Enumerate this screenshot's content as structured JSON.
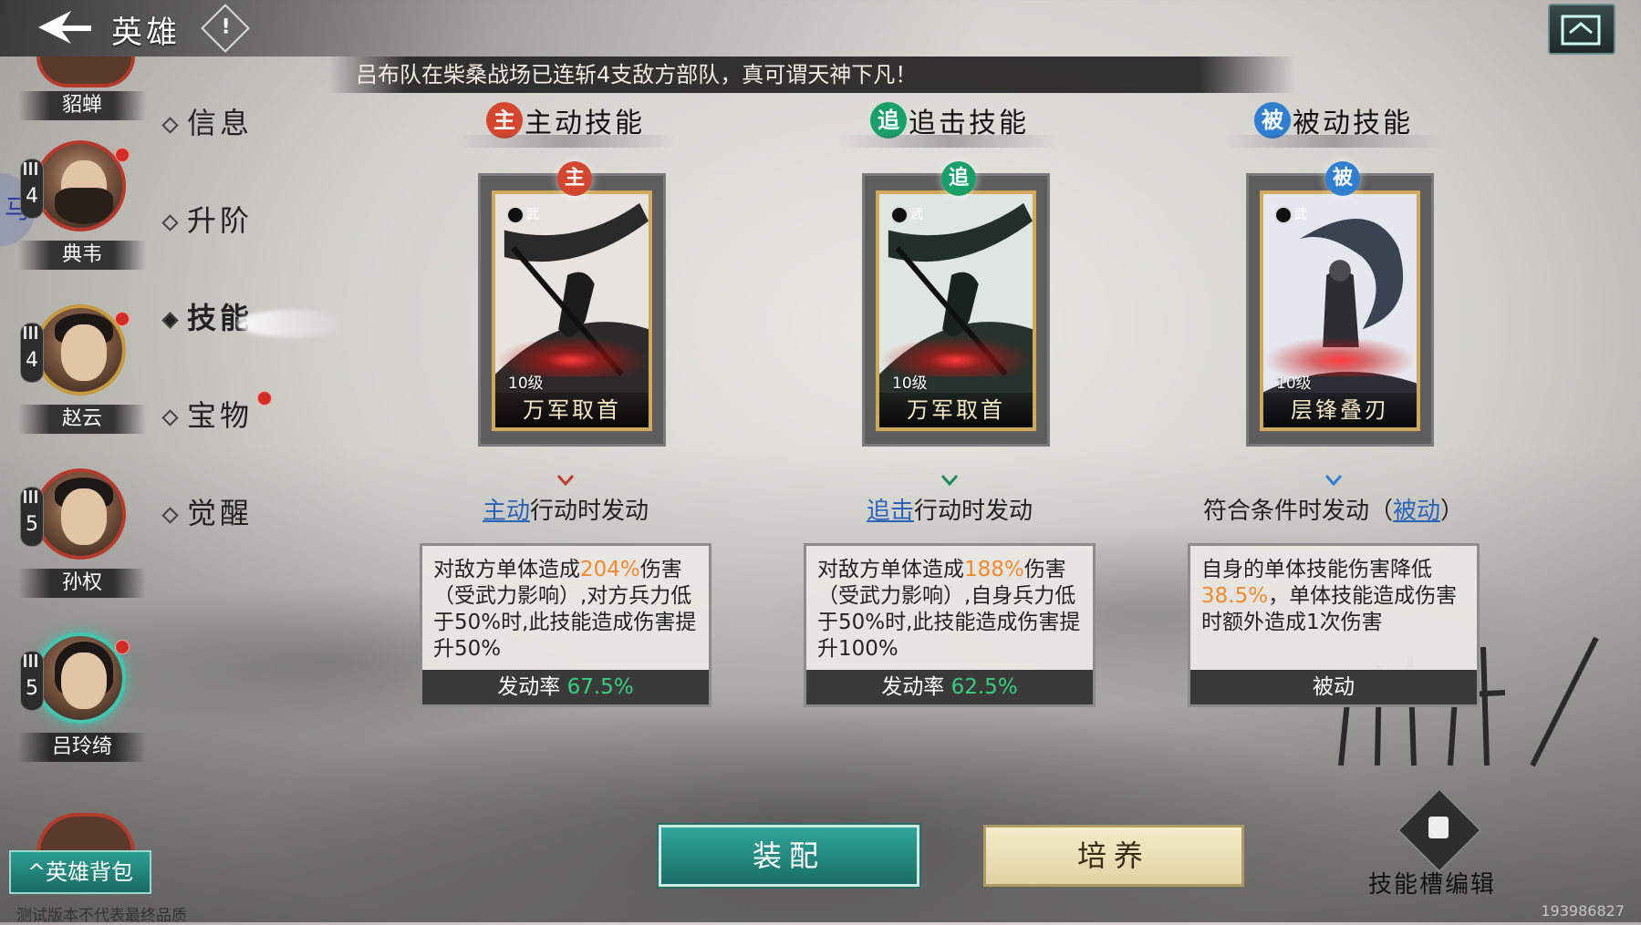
{
  "header": {
    "title": "英雄",
    "info_mark": "!"
  },
  "ribbon": {
    "text": "吕布队在柴桑战场已连斩4支敌方部队，真可谓天神下凡！"
  },
  "heroes": [
    {
      "name": "貂蝉"
    },
    {
      "name": "典韦",
      "level": "4"
    },
    {
      "name": "赵云",
      "level": "4"
    },
    {
      "name": "孙权",
      "level": "5"
    },
    {
      "name": "吕玲绮",
      "level": "5",
      "selected": true
    }
  ],
  "side_glyph": "马",
  "nav": [
    {
      "label": "信息"
    },
    {
      "label": "升阶"
    },
    {
      "label": "技能",
      "active": true
    },
    {
      "label": "宝物"
    },
    {
      "label": "觉醒"
    }
  ],
  "skills": [
    {
      "type_char": "主",
      "type_label": "主动技能",
      "color": "#d4472e",
      "chevron_color": "#c0392b",
      "card": {
        "tag": "武",
        "level": "10级",
        "name": "万军取首"
      },
      "trigger_kw": "主动",
      "trigger_rest": "行动时发动",
      "desc_pre": "对敌方单体造成",
      "desc_val": "204%",
      "desc_post": "伤害（受武力影响）,对方兵力低于50%时,此技能造成伤害提升50%",
      "foot_label": "发动率",
      "foot_rate": "67.5%"
    },
    {
      "type_char": "追",
      "type_label": "追击技能",
      "color": "#19a06a",
      "chevron_color": "#1e8c5a",
      "card": {
        "tag": "武",
        "level": "10级",
        "name": "万军取首"
      },
      "trigger_kw": "追击",
      "trigger_rest": "行动时发动",
      "desc_pre": "对敌方单体造成",
      "desc_val": "188%",
      "desc_post": "伤害（受武力影响）,自身兵力低于50%时,此技能造成伤害提升100%",
      "foot_label": "发动率",
      "foot_rate": "62.5%"
    },
    {
      "type_char": "被",
      "type_label": "被动技能",
      "color": "#2f7fd1",
      "chevron_color": "#2f7fd1",
      "card": {
        "tag": "武",
        "level": "10级",
        "name": "层锋叠刃"
      },
      "trigger_pre": "符合条件时发动（",
      "trigger_kw": "被动",
      "trigger_post": "）",
      "desc_pre": "自身的单体技能伤害降低",
      "desc_val": "38.5%",
      "desc_post": "，单体技能造成伤害时额外造成1次伤害",
      "foot_label": "被动"
    }
  ],
  "buttons": {
    "equip": "装配",
    "train": "培养",
    "slot_edit": "技能槽编辑",
    "hero_bag": "英雄背包",
    "hero_bag_caret": "^"
  },
  "footer": {
    "disclaimer": "测试版本不代表最终品质",
    "build_id": "193986827"
  }
}
